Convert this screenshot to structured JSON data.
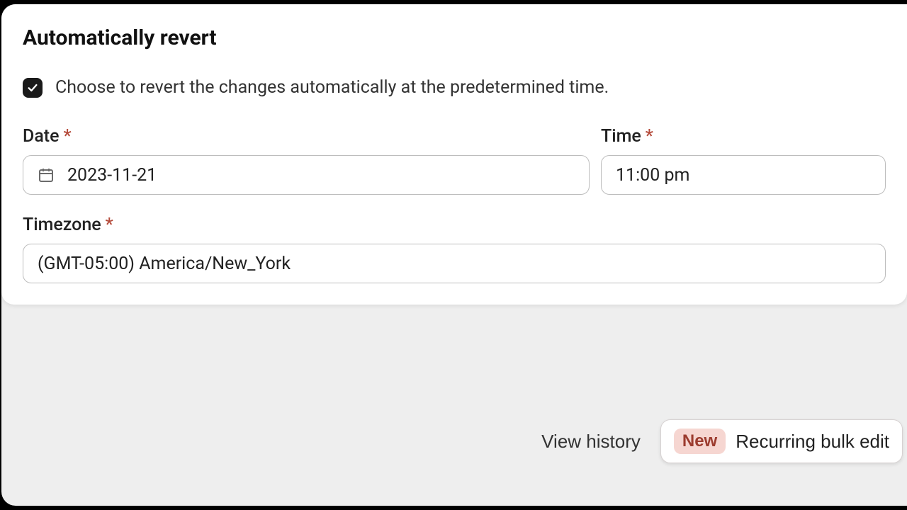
{
  "section": {
    "title": "Automatically revert",
    "checkbox_label": "Choose to revert the changes automatically at the predetermined time."
  },
  "fields": {
    "date": {
      "label": "Date",
      "value": "2023-11-21"
    },
    "time": {
      "label": "Time",
      "value": "11:00 pm"
    },
    "timezone": {
      "label": "Timezone",
      "value": "(GMT-05:00) America/New_York"
    }
  },
  "footer": {
    "view_history": "View history",
    "badge_new": "New",
    "recurring": "Recurring bulk edit"
  },
  "required_marker": "*"
}
